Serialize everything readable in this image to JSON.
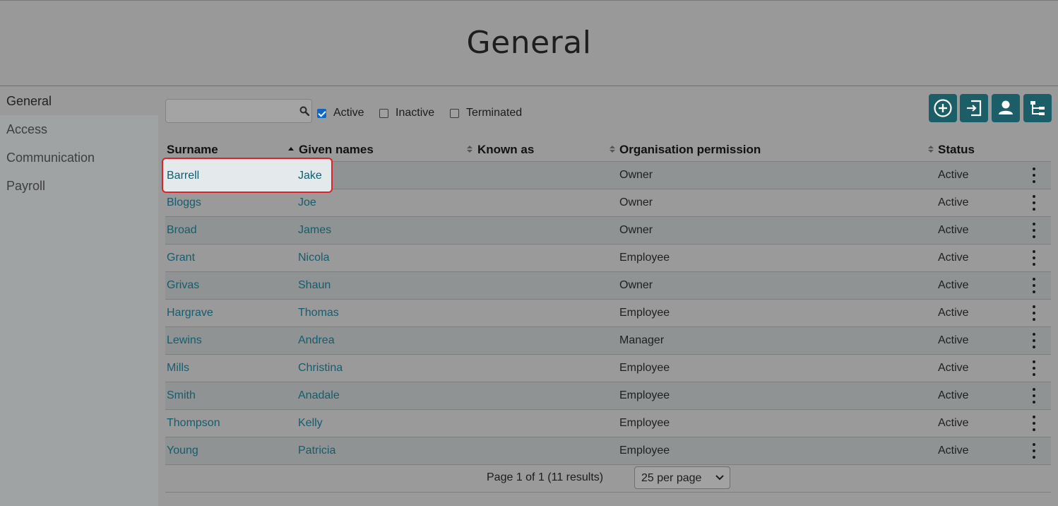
{
  "page": {
    "title": "General"
  },
  "sidebar": {
    "items": [
      {
        "label": "General"
      },
      {
        "label": "Access"
      },
      {
        "label": "Communication"
      },
      {
        "label": "Payroll"
      }
    ]
  },
  "toolbar": {
    "search": {
      "value": "",
      "placeholder": ""
    },
    "filters": [
      {
        "label": "Active",
        "checked": true
      },
      {
        "label": "Inactive",
        "checked": false
      },
      {
        "label": "Terminated",
        "checked": false
      }
    ],
    "buttons": [
      {
        "icon": "add-circle-icon"
      },
      {
        "icon": "import-icon"
      },
      {
        "icon": "person-icon"
      },
      {
        "icon": "org-chart-icon"
      }
    ]
  },
  "table": {
    "columns": [
      "Surname",
      "Given names",
      "Known as",
      "Organisation permission",
      "Status"
    ],
    "rows": [
      {
        "surname": "Barrell",
        "given": "Jake",
        "known": "",
        "permission": "Owner",
        "status": "Active"
      },
      {
        "surname": "Bloggs",
        "given": "Joe",
        "known": "",
        "permission": "Owner",
        "status": "Active"
      },
      {
        "surname": "Broad",
        "given": "James",
        "known": "",
        "permission": "Owner",
        "status": "Active"
      },
      {
        "surname": "Grant",
        "given": "Nicola",
        "known": "",
        "permission": "Employee",
        "status": "Active"
      },
      {
        "surname": "Grivas",
        "given": "Shaun",
        "known": "",
        "permission": "Owner",
        "status": "Active"
      },
      {
        "surname": "Hargrave",
        "given": "Thomas",
        "known": "",
        "permission": "Employee",
        "status": "Active"
      },
      {
        "surname": "Lewins",
        "given": "Andrea",
        "known": "",
        "permission": "Manager",
        "status": "Active"
      },
      {
        "surname": "Mills",
        "given": "Christina",
        "known": "",
        "permission": "Employee",
        "status": "Active"
      },
      {
        "surname": "Smith",
        "given": "Anadale",
        "known": "",
        "permission": "Employee",
        "status": "Active"
      },
      {
        "surname": "Thompson",
        "given": "Kelly",
        "known": "",
        "permission": "Employee",
        "status": "Active"
      },
      {
        "surname": "Young",
        "given": "Patricia",
        "known": "",
        "permission": "Employee",
        "status": "Active"
      }
    ]
  },
  "pager": {
    "text": "Page 1 of 1 (11 results)",
    "per_page": "25 per page"
  },
  "colors": {
    "accent": "#1c5e68",
    "link": "#155d6e",
    "highlight_border": "#e0202a",
    "checkbox": "#0a67c8"
  }
}
